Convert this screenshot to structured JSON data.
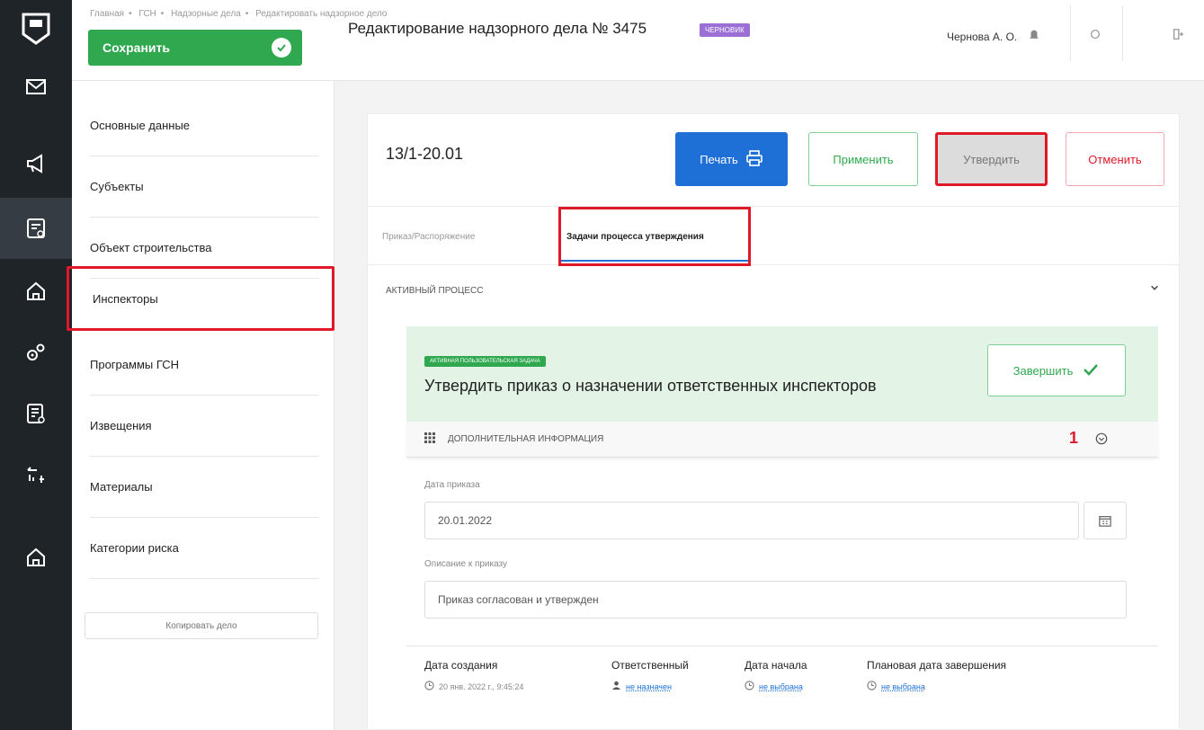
{
  "breadcrumb": [
    "Главная",
    "ГСН",
    "Надзорные дела",
    "Редактировать надзорное дело"
  ],
  "header": {
    "save_label": "Сохранить",
    "title": "Редактирование надзорного дела № 3475",
    "badge": "черновик",
    "user": "Чернова А. О."
  },
  "rail_icons": [
    "logo-icon",
    "mail-icon",
    "megaphone-icon",
    "document-code-icon",
    "home-icon",
    "settings-gears-icon",
    "report-icon",
    "transfer-icon",
    "home-icon"
  ],
  "sidebar": {
    "items": [
      {
        "label": "Основные данные"
      },
      {
        "label": "Субъекты"
      },
      {
        "label": "Объект строительства"
      },
      {
        "label": "Инспекторы"
      },
      {
        "label": "Программы ГСН"
      },
      {
        "label": "Извещения"
      },
      {
        "label": "Материалы"
      },
      {
        "label": "Категории риска"
      }
    ],
    "copy_label": "Копировать дело"
  },
  "document": {
    "number": "13/1-20.01",
    "print_label": "Печать",
    "apply_label": "Применить",
    "approve_label": "Утвердить",
    "cancel_label": "Отменить"
  },
  "tabs": [
    {
      "label": "Приказ/Распоряжение"
    },
    {
      "label": "Задачи процесса утверждения"
    }
  ],
  "process": {
    "label": "активный процесс"
  },
  "task": {
    "badge": "активная пользовательская задача",
    "title": "Утвердить приказ о назначении ответственных инспекторов",
    "finish_label": "Завершить"
  },
  "additional": {
    "label": "дополнительная информация",
    "marker": "1"
  },
  "form": {
    "date_label": "Дата приказа",
    "date_value": "20.01.2022",
    "desc_label": "Описание к приказу",
    "desc_value": "Приказ согласован и утвержден"
  },
  "meta": {
    "created_label": "Дата создания",
    "created_value": "20 янв. 2022 г., 9:45:24",
    "responsible_label": "Ответственный",
    "responsible_value": "не назначен",
    "start_label": "Дата начала",
    "start_value": "не выбрана",
    "planned_label": "Плановая дата завершения",
    "planned_value": "не выбрана"
  },
  "colors": {
    "rail_bg": "#1f2429",
    "save_green": "#2fa84f",
    "print_blue": "#1e6fd6",
    "highlight_red": "#e0192a",
    "badge_purple": "#9c6fd6",
    "task_bg": "#e3f3e6"
  }
}
